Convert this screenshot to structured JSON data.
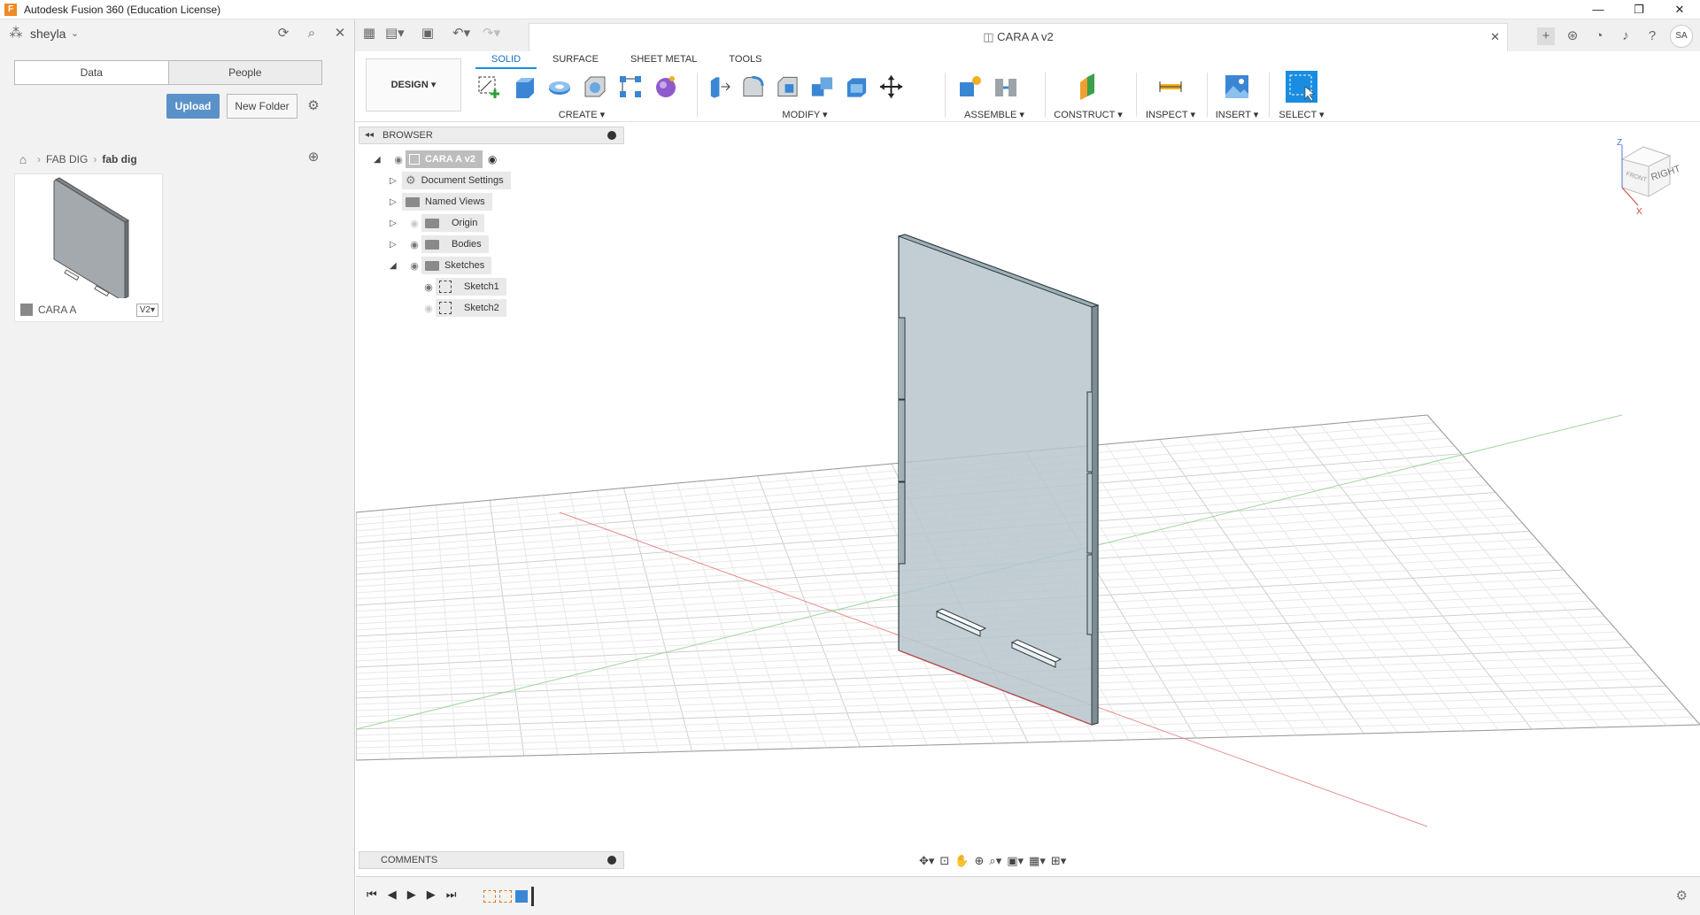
{
  "window": {
    "title": "Autodesk Fusion 360 (Education License)",
    "logo_letter": "F",
    "controls": [
      "—",
      "❐",
      "✕"
    ]
  },
  "data_panel": {
    "user": "sheyla",
    "tabs": [
      "Data",
      "People"
    ],
    "upload_label": "Upload",
    "new_folder_label": "New Folder",
    "breadcrumb": [
      "FAB DIG",
      "fab dig"
    ],
    "files": [
      {
        "name": "CARA A",
        "version": "V2"
      }
    ]
  },
  "appbar": {
    "document_title": "CARA A v2",
    "user_initials": "SA"
  },
  "toolbar": {
    "workspace": "DESIGN",
    "tabs": [
      "SOLID",
      "SURFACE",
      "SHEET METAL",
      "TOOLS"
    ],
    "active_tab": "SOLID",
    "groups": [
      "CREATE",
      "MODIFY",
      "ASSEMBLE",
      "CONSTRUCT",
      "INSPECT",
      "INSERT",
      "SELECT"
    ]
  },
  "browser": {
    "title": "BROWSER",
    "root": "CARA A v2",
    "items": [
      "Document Settings",
      "Named Views",
      "Origin",
      "Bodies",
      "Sketches"
    ],
    "sketches": [
      "Sketch1",
      "Sketch2"
    ]
  },
  "comments": {
    "title": "COMMENTS"
  },
  "viewcube": {
    "right_label": "RIGHT",
    "front_label": "FRONT",
    "z_axis": "Z",
    "x_axis": "X"
  },
  "colors": {
    "accent": "#1a8de0",
    "upload": "#5a91c9",
    "part_fill": "#b7c6cc",
    "part_edge": "#2d3a40"
  }
}
